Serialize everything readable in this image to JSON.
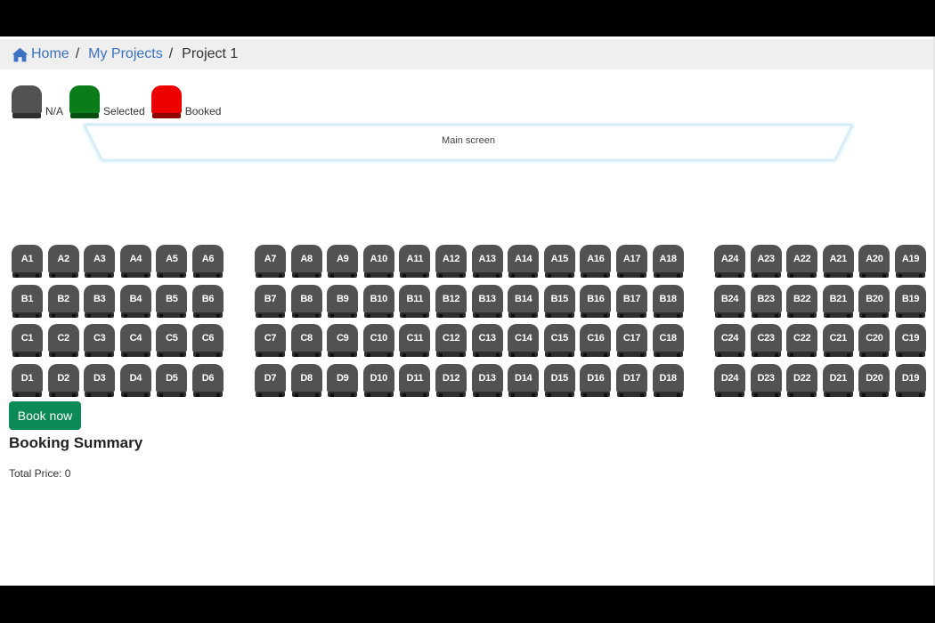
{
  "breadcrumb": {
    "home": "Home",
    "projects": "My Projects",
    "current": "Project 1",
    "separator": "/"
  },
  "legend": [
    {
      "key": "na",
      "label": "N/A",
      "color": "#525252",
      "base": "#2f2f2f"
    },
    {
      "key": "selected",
      "label": "Selected",
      "color": "#0a7d1a",
      "base": "#064f10"
    },
    {
      "key": "booked",
      "label": "Booked",
      "color": "#ee0000",
      "base": "#8f0000"
    }
  ],
  "screen": {
    "label": "Main screen"
  },
  "seating": {
    "rows": [
      "A",
      "B",
      "C",
      "D"
    ],
    "sections": [
      {
        "name": "left",
        "numbers": [
          1,
          2,
          3,
          4,
          5,
          6
        ]
      },
      {
        "name": "center",
        "numbers": [
          7,
          8,
          9,
          10,
          11,
          12,
          13,
          14,
          15,
          16,
          17,
          18
        ]
      },
      {
        "name": "right",
        "numbers": [
          24,
          23,
          22,
          21,
          20,
          19
        ]
      }
    ],
    "status": "na"
  },
  "booking": {
    "button_label": "Book now",
    "summary_title": "Booking Summary",
    "total_price_label": "Total Price: 0"
  },
  "colors": {
    "link": "#3a72c4",
    "book_button": "#0c8a55",
    "seat_available": "#525252"
  }
}
